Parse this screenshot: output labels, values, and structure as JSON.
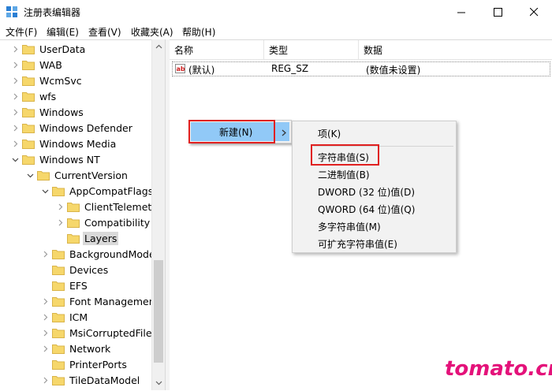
{
  "window": {
    "title": "注册表编辑器",
    "minimize_label": "─",
    "maximize_label": "☐",
    "close_label": "✕"
  },
  "menubar": {
    "items": [
      "文件(F)",
      "编辑(E)",
      "查看(V)",
      "收藏夹(A)",
      "帮助(H)"
    ]
  },
  "tree": {
    "items": [
      {
        "label": "UserData",
        "expandable": true
      },
      {
        "label": "WAB",
        "expandable": true
      },
      {
        "label": "WcmSvc",
        "expandable": true
      },
      {
        "label": "wfs",
        "expandable": true
      },
      {
        "label": "Windows",
        "expandable": true
      },
      {
        "label": "Windows Defender",
        "expandable": true
      },
      {
        "label": "Windows Media",
        "expandable": true
      },
      {
        "label": "Windows NT",
        "expandable": true,
        "expanded": true
      },
      {
        "label": "CurrentVersion",
        "expandable": true,
        "expanded": true
      },
      {
        "label": "AppCompatFlags",
        "expandable": true,
        "expanded": true
      },
      {
        "label": "ClientTelemetr",
        "expandable": true
      },
      {
        "label": "Compatibility A",
        "expandable": true
      },
      {
        "label": "Layers",
        "expandable": false,
        "selected": true
      },
      {
        "label": "BackgroundMode",
        "expandable": true
      },
      {
        "label": "Devices",
        "expandable": false
      },
      {
        "label": "EFS",
        "expandable": false
      },
      {
        "label": "Font Management",
        "expandable": true
      },
      {
        "label": "ICM",
        "expandable": true
      },
      {
        "label": "MsiCorruptedFile",
        "expandable": true
      },
      {
        "label": "Network",
        "expandable": true
      },
      {
        "label": "PrinterPorts",
        "expandable": false
      },
      {
        "label": "TileDataModel",
        "expandable": true
      }
    ]
  },
  "list": {
    "columns": [
      "名称",
      "类型",
      "数据"
    ],
    "rows": [
      {
        "name": "(默认)",
        "type": "REG_SZ",
        "data": "(数值未设置)"
      }
    ]
  },
  "context_menu": {
    "new_label": "新建(N)",
    "new_arrow": "›"
  },
  "submenu": {
    "key_label": "项(K)",
    "items": [
      "字符串值(S)",
      "二进制值(B)",
      "DWORD (32 位)值(D)",
      "QWORD (64 位)值(Q)",
      "多字符串值(M)",
      "可扩充字符串值(E)"
    ]
  },
  "watermark": "tomato.cm",
  "colors": {
    "highlight": "#91c9f7",
    "annotation_red": "#e02020",
    "folder_yellow": "#f6d76b",
    "watermark": "#e4127a"
  }
}
